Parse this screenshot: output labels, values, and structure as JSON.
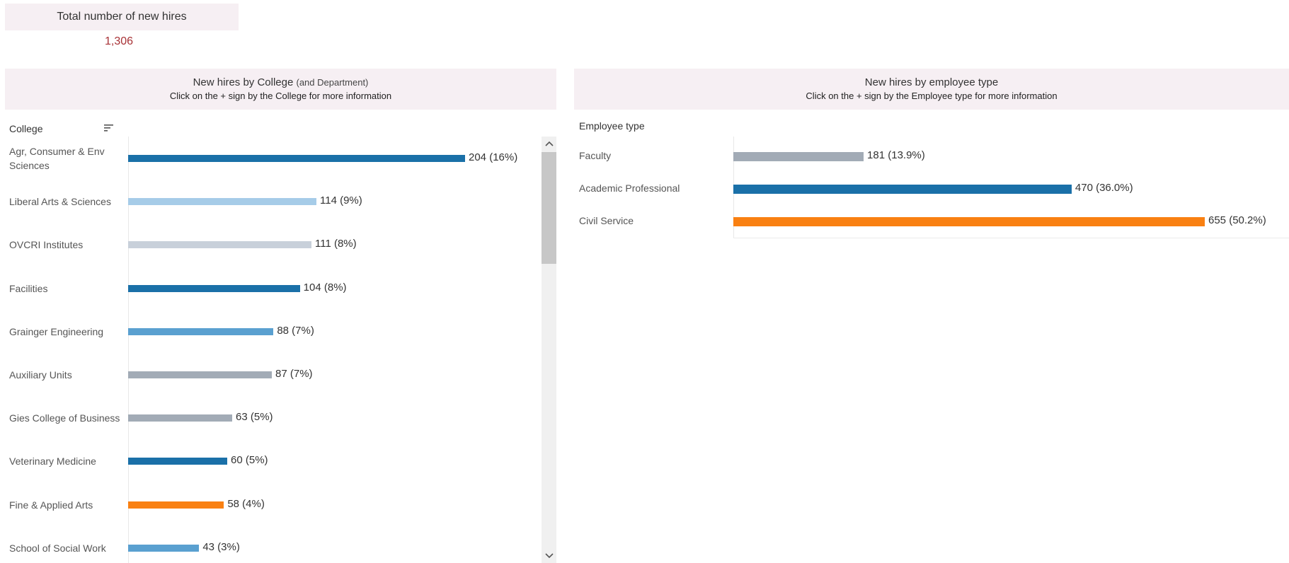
{
  "total": {
    "label": "Total number of new hires",
    "value": "1,306"
  },
  "college_panel": {
    "title": "New hires by College",
    "title_suffix": "(and Department)",
    "subtitle": "Click on the + sign by the College for more information",
    "column_header": "College",
    "sort_icon": "sort-descending-icon"
  },
  "employee_panel": {
    "title": "New hires by employee type",
    "subtitle": "Click on the + sign by the Employee type for more information",
    "column_header": "Employee type"
  },
  "colors": {
    "dark_blue": "#1a70a8",
    "light_blue": "#a6cce8",
    "light_gray": "#c8d0da",
    "mid_blue": "#5aa0d0",
    "gray": "#a2abb6",
    "orange": "#f98012",
    "accent_red": "#a83236",
    "header_bg": "#f6eff3"
  },
  "chart_data": [
    {
      "type": "bar",
      "orientation": "horizontal",
      "categories": [
        "Agr, Consumer & Env Sciences",
        "Liberal Arts & Sciences",
        "OVCRI Institutes",
        "Facilities",
        "Grainger Engineering",
        "Auxiliary Units",
        "Gies College of Business",
        "Veterinary Medicine",
        "Fine & Applied Arts",
        "School of Social Work"
      ],
      "values": [
        204,
        114,
        111,
        104,
        88,
        87,
        63,
        60,
        58,
        43
      ],
      "data_labels": [
        "204 (16%)",
        "114 (9%)",
        "111 (8%)",
        "104 (8%)",
        "88 (7%)",
        "87 (7%)",
        "63 (5%)",
        "60 (5%)",
        "58 (4%)",
        "43 (3%)"
      ],
      "bar_colors": [
        "#1a70a8",
        "#a6cce8",
        "#c8d0da",
        "#1a70a8",
        "#5aa0d0",
        "#a2abb6",
        "#a2abb6",
        "#1a70a8",
        "#f98012",
        "#5aa0d0"
      ],
      "xlim": [
        0,
        204
      ]
    },
    {
      "type": "bar",
      "orientation": "horizontal",
      "categories": [
        "Faculty",
        "Academic Professional",
        "Civil Service"
      ],
      "values": [
        181,
        470,
        655
      ],
      "data_labels": [
        "181 (13.9%)",
        "470 (36.0%)",
        "655 (50.2%)"
      ],
      "bar_colors": [
        "#a2abb6",
        "#1a70a8",
        "#f98012"
      ],
      "xlim": [
        0,
        655
      ]
    }
  ]
}
